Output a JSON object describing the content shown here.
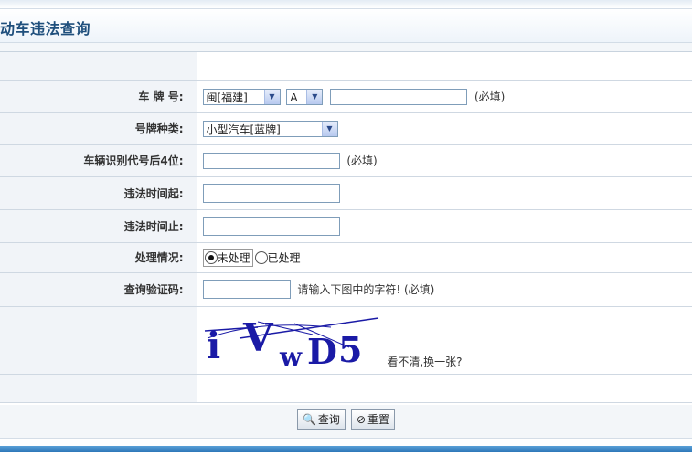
{
  "page": {
    "title": "动车违法查询"
  },
  "form": {
    "plate": {
      "label": "车 牌 号:",
      "province": "闽[福建]",
      "letter": "A",
      "value": "",
      "hint": "(必填)"
    },
    "plate_type": {
      "label": "号牌种类:",
      "value": "小型汽车[蓝牌]"
    },
    "vin": {
      "label": "车辆识别代号后4位:",
      "value": "",
      "hint": "(必填)"
    },
    "start_time": {
      "label": "违法时间起:",
      "value": ""
    },
    "end_time": {
      "label": "违法时间止:",
      "value": ""
    },
    "status": {
      "label": "处理情况:",
      "options": [
        {
          "label": "未处理",
          "checked": true
        },
        {
          "label": "已处理",
          "checked": false
        }
      ]
    },
    "captcha": {
      "label": "查询验证码:",
      "value": "",
      "hint": "请输入下图中的字符! (必填)",
      "image_text": "iVwD5",
      "refresh_link": "看不清,换一张?"
    }
  },
  "buttons": {
    "query": {
      "label": "查询",
      "icon": "search-icon"
    },
    "reset": {
      "label": "重置",
      "icon": "no-icon"
    }
  },
  "colors": {
    "title": "#1f4f7c",
    "captcha_ink": "#1a1aa6",
    "label_bg": "#f1f4f8",
    "bottom_stripe": "#2d77b8"
  }
}
